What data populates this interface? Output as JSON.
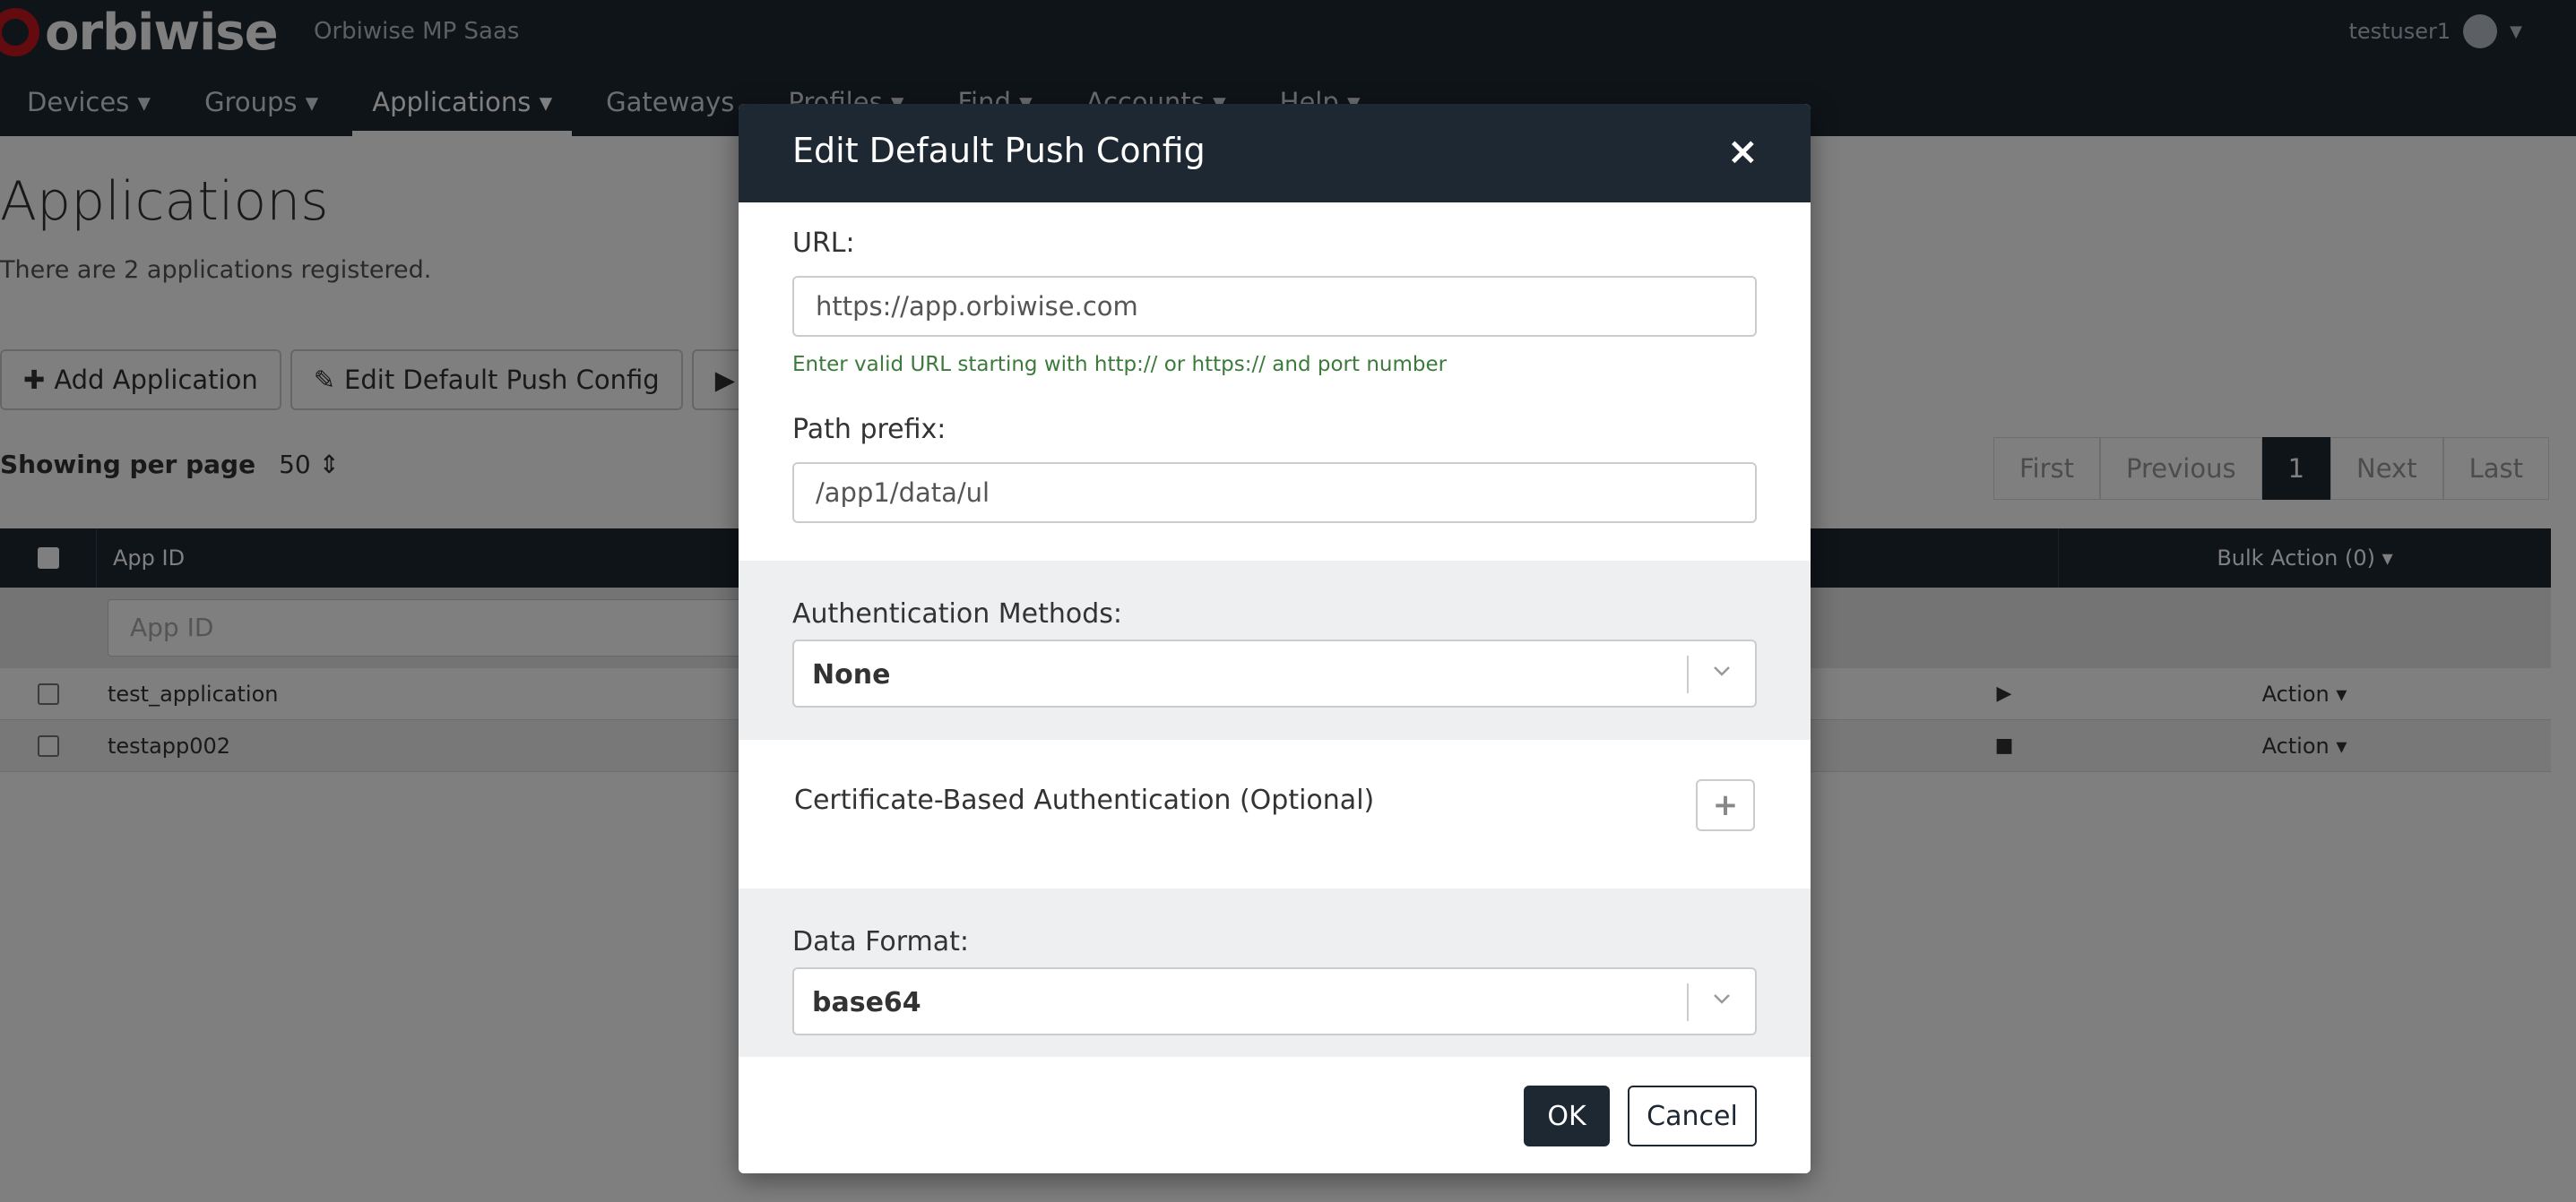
{
  "app": {
    "brand": "orbiwise",
    "product_name": "Orbiwise MP Saas",
    "user": "testuser1"
  },
  "nav": {
    "items": [
      {
        "label": "Devices ▾"
      },
      {
        "label": "Groups ▾"
      },
      {
        "label": "Applications ▾"
      },
      {
        "label": "Gateways"
      },
      {
        "label": "Profiles ▾"
      },
      {
        "label": "Find ▾"
      },
      {
        "label": "Accounts ▾"
      },
      {
        "label": "Help ▾"
      }
    ],
    "active": "Applications ▾"
  },
  "page": {
    "title": "Applications",
    "subtitle": "There are 2 applications registered.",
    "toolbar": {
      "add_label": "Add Application",
      "edit_label": "Edit Default Push Config"
    },
    "per_page_label": "Showing per page",
    "per_page_value": "50 ⇕",
    "pager": {
      "first": "First",
      "previous": "Previous",
      "current": "1",
      "next": "Next",
      "last": "Last"
    },
    "table": {
      "col_app_id": "App ID",
      "col_bulk": "Bulk Action (0) ▾",
      "filter_placeholder": "App ID",
      "rows": [
        {
          "name": "test_application",
          "state": "▶",
          "action": "Action ▾"
        },
        {
          "name": "testapp002",
          "state": "■",
          "action": "Action ▾"
        }
      ]
    }
  },
  "modal": {
    "title": "Edit Default Push Config",
    "close_icon": "×",
    "url_label": "URL:",
    "url_value": "https://app.orbiwise.com",
    "url_help": "Enter valid URL starting with http:// or https:// and port number",
    "path_label": "Path prefix:",
    "path_value": "/app1/data/ul",
    "auth_label": "Authentication Methods:",
    "auth_value": "None",
    "cert_label": "Certificate-Based Authentication (Optional)",
    "cert_add": "+",
    "format_label": "Data Format:",
    "format_value": "base64",
    "ok_label": "OK",
    "cancel_label": "Cancel"
  },
  "colors": {
    "header_bg": "#1e2833",
    "brand_red": "#c8161e",
    "help_green": "#3c7a3c",
    "section_grey": "#edeff0"
  }
}
